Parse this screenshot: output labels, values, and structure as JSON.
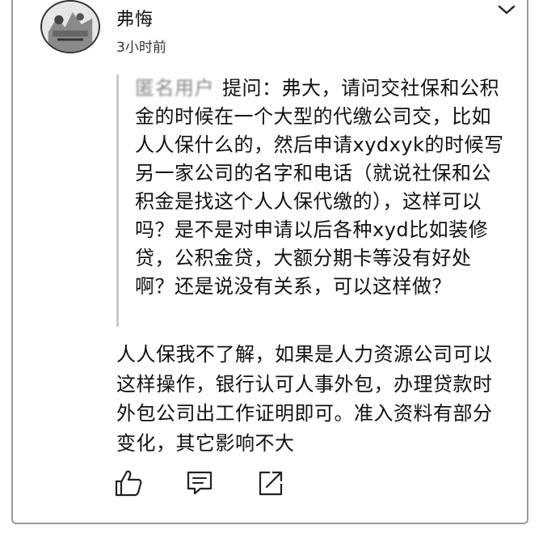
{
  "post": {
    "author": "弗悔",
    "time": "3小时前"
  },
  "quote": {
    "user": "匿名用户",
    "text": "提问：弗大，请问交社保和公积金的时候在一个大型的代缴公司交，比如人人保什么的，然后申请xydxyk的时候写另一家公司的名字和电话（就说社保和公积金是找这个人人保代缴的），这样可以吗？是不是对申请以后各种xyd比如装修贷，公积金贷，大额分期卡等没有好处啊？还是说没有关系，可以这样做？"
  },
  "answer": {
    "text": "人人保我不了解，如果是人力资源公司可以这样操作，银行认可人事外包，办理贷款时外包公司出工作证明即可。准入资料有部分变化，其它影响不大"
  },
  "icons": {
    "avatar": "avatar-image",
    "menu": "chevron-down-icon",
    "like": "thumbs-up-icon",
    "comment": "comment-icon",
    "share": "share-icon"
  }
}
